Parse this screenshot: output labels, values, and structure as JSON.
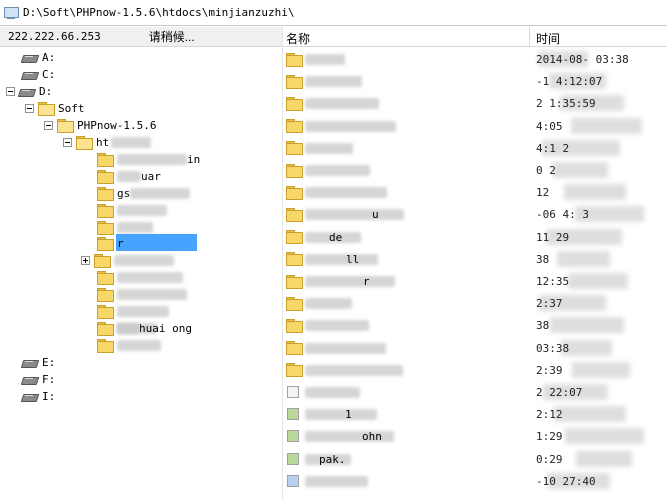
{
  "window": {
    "path": "D:\\Soft\\PHPnow-1.5.6\\htdocs\\minjianzuzhi\\"
  },
  "header": {
    "ip": "222.222.66.253",
    "status": "请稍候...",
    "col_name": "名称",
    "col_time": "时间"
  },
  "tree": {
    "drives_top": [
      {
        "label": "A:"
      },
      {
        "label": "C:"
      },
      {
        "label": "D:"
      }
    ],
    "soft": "Soft",
    "phpnow": "PHPnow-1.5.6",
    "htdocs_partial": "ht",
    "children": [
      {
        "label_partial": "in"
      },
      {
        "label_partial": "uar"
      },
      {
        "label_partial": "gs"
      },
      {
        "label_partial": ""
      },
      {
        "label_partial": ""
      },
      {
        "label_partial": "r"
      },
      {
        "label_partial": ""
      },
      {
        "label_partial": ""
      },
      {
        "label_partial": ""
      },
      {
        "label_partial": ""
      },
      {
        "label_partial": "huai ong"
      },
      {
        "label_partial": ""
      }
    ],
    "drives_bottom": [
      {
        "label": "E:"
      },
      {
        "label": "F:"
      },
      {
        "label": "I:"
      }
    ]
  },
  "files": [
    {
      "name": "",
      "time": "2014-08-     03:38"
    },
    {
      "name": "",
      "time": "   -1     4:12:07"
    },
    {
      "name": "",
      "time": "2         1:35:59"
    },
    {
      "name": "",
      "time": "          4:05"
    },
    {
      "name": "",
      "time": "          4:1  2"
    },
    {
      "name": "",
      "time": "          0   2"
    },
    {
      "name": "",
      "time": "          12"
    },
    {
      "name": "u",
      "time": "    -06     4: 3"
    },
    {
      "name": "de",
      "time": "       11     29"
    },
    {
      "name": "ll",
      "time": "              38"
    },
    {
      "name": "r",
      "time": "           12:35"
    },
    {
      "name": "",
      "time": "            2:37"
    },
    {
      "name": "",
      "time": "              38"
    },
    {
      "name": "",
      "time": "           03:38"
    },
    {
      "name": "",
      "time": "            2:39"
    },
    {
      "name": "",
      "time": "          2 22:07"
    },
    {
      "name": "1",
      "time": "           2:12"
    },
    {
      "name": "ohn",
      "time": "            1:29"
    },
    {
      "name": "pak.",
      "time": "            0:29"
    },
    {
      "name": "",
      "time": "     -10    27:40"
    }
  ],
  "icons": {
    "drive": "drive-icon",
    "folder": "folder-icon",
    "computer": "computer-icon"
  }
}
